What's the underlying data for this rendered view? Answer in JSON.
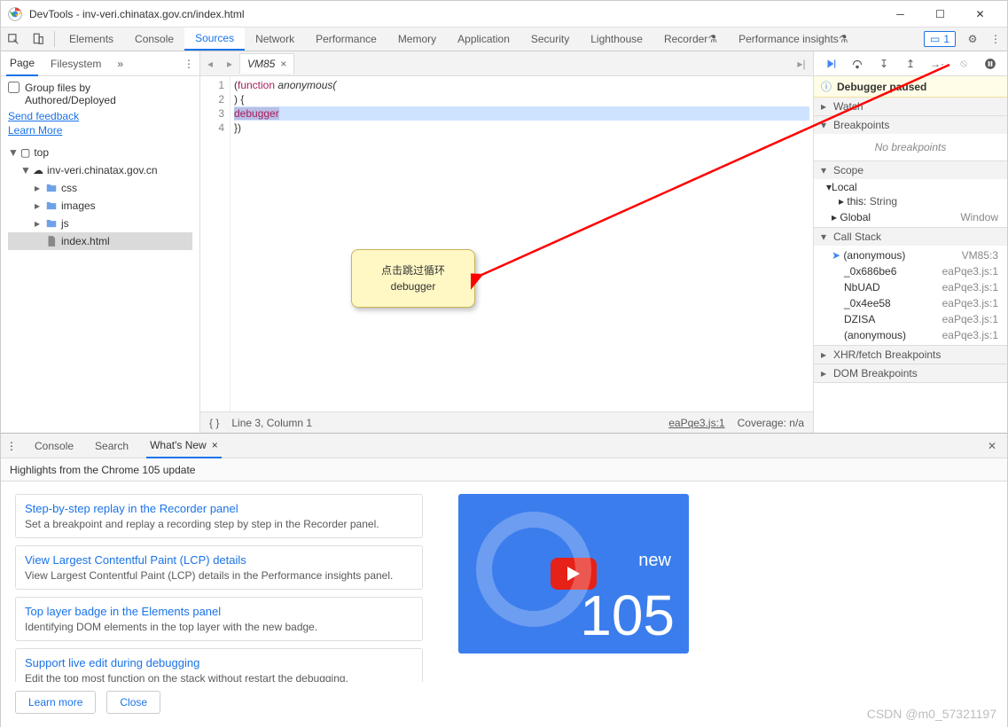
{
  "window": {
    "title": "DevTools - inv-veri.chinatax.gov.cn/index.html"
  },
  "mainTabs": {
    "elements": "Elements",
    "console": "Console",
    "sources": "Sources",
    "network": "Network",
    "performance": "Performance",
    "memory": "Memory",
    "application": "Application",
    "security": "Security",
    "lighthouse": "Lighthouse",
    "recorder": "Recorder",
    "perfinsights": "Performance insights",
    "messageCount": "1"
  },
  "navigator": {
    "tabs": {
      "page": "Page",
      "filesystem": "Filesystem"
    },
    "group": {
      "line1": "Group files by",
      "line2": "Authored/Deployed"
    },
    "links": {
      "feedback": "Send feedback",
      "learn": "Learn More"
    },
    "tree": {
      "top": "top",
      "domain": "inv-veri.chinatax.gov.cn",
      "folders": {
        "css": "css",
        "images": "images",
        "js": "js"
      },
      "file": "index.html"
    }
  },
  "editor": {
    "tab": "VM85",
    "lines": {
      "l1a": "(",
      "l1b": "function",
      "l1c": " anonymous(",
      "l2": ") {",
      "l3": "debugger",
      "l4": "})"
    },
    "gutter": {
      "n1": "1",
      "n2": "2",
      "n3": "3",
      "n4": "4"
    },
    "status": {
      "pos": "Line 3, Column 1",
      "src": "eaPqe3.js:1",
      "cov": "Coverage: n/a"
    }
  },
  "debugger": {
    "paused": "Debugger paused",
    "panes": {
      "watch": "Watch",
      "breakpoints": "Breakpoints",
      "noBreakpoints": "No breakpoints",
      "scope": "Scope",
      "local": "Local",
      "thisLabel": "this",
      "thisValue": "String",
      "global": "Global",
      "globalValue": "Window",
      "callstack": "Call Stack",
      "xhr": "XHR/fetch Breakpoints",
      "dom": "DOM Breakpoints"
    },
    "stack": [
      {
        "name": "(anonymous)",
        "loc": "VM85:3"
      },
      {
        "name": "_0x686be6",
        "loc": "eaPqe3.js:1"
      },
      {
        "name": "NbUAD",
        "loc": "eaPqe3.js:1"
      },
      {
        "name": "_0x4ee58",
        "loc": "eaPqe3.js:1"
      },
      {
        "name": "DZISA",
        "loc": "eaPqe3.js:1"
      },
      {
        "name": "(anonymous)",
        "loc": "eaPqe3.js:1"
      }
    ]
  },
  "drawer": {
    "tabs": {
      "console": "Console",
      "search": "Search",
      "whatsnew": "What's New"
    },
    "subtitle": "Highlights from the Chrome 105 update",
    "cards": [
      {
        "title": "Step-by-step replay in the Recorder panel",
        "desc": "Set a breakpoint and replay a recording step by step in the Recorder panel."
      },
      {
        "title": "View Largest Contentful Paint (LCP) details",
        "desc": "View Largest Contentful Paint (LCP) details in the Performance insights panel."
      },
      {
        "title": "Top layer badge in the Elements panel",
        "desc": "Identifying DOM elements in the top layer with the new badge."
      },
      {
        "title": "Support live edit during debugging",
        "desc": "Edit the top most function on the stack without restart the debugging."
      }
    ],
    "promo": {
      "new": "new",
      "ver": "105"
    },
    "buttons": {
      "learn": "Learn more",
      "close": "Close"
    }
  },
  "callout": {
    "l1": "点击跳过循环",
    "l2": "debugger"
  },
  "watermark": "CSDN @m0_57321197"
}
